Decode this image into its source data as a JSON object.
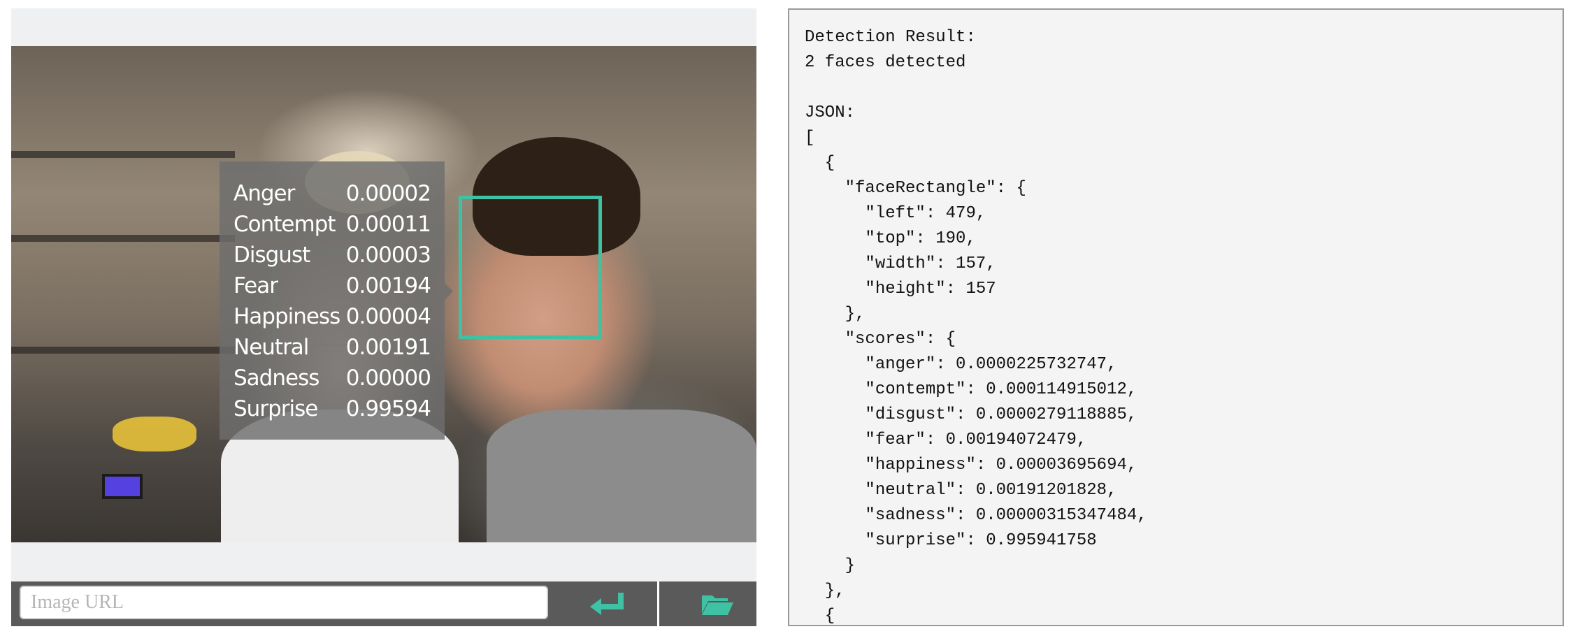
{
  "emotion_panel": {
    "scores": [
      {
        "label": "Anger",
        "value": "0.00002"
      },
      {
        "label": "Contempt",
        "value": "0.00011"
      },
      {
        "label": "Disgust",
        "value": "0.00003"
      },
      {
        "label": "Fear",
        "value": "0.00194"
      },
      {
        "label": "Happiness",
        "value": "0.00004"
      },
      {
        "label": "Neutral",
        "value": "0.00191"
      },
      {
        "label": "Sadness",
        "value": "0.00000"
      },
      {
        "label": "Surprise",
        "value": "0.99594"
      }
    ]
  },
  "toolbar": {
    "url_placeholder": "Image URL",
    "url_value": "",
    "submit_icon": "enter-arrow-icon",
    "browse_icon": "folder-open-icon",
    "accent_color": "#3fc1a4"
  },
  "colors": {
    "face_box": "#3fc1a4",
    "toolbar_bg": "#5a5a5a",
    "tooltip_bg": "#6e6e6e"
  },
  "result_panel": {
    "text": "Detection Result:\n2 faces detected\n\nJSON:\n[\n  {\n    \"faceRectangle\": {\n      \"left\": 479,\n      \"top\": 190,\n      \"width\": 157,\n      \"height\": 157\n    },\n    \"scores\": {\n      \"anger\": 0.0000225732747,\n      \"contempt\": 0.000114915012,\n      \"disgust\": 0.0000279118885,\n      \"fear\": 0.00194072479,\n      \"happiness\": 0.00003695694,\n      \"neutral\": 0.00191201828,\n      \"sadness\": 0.00000315347484,\n      \"surprise\": 0.995941758\n    }\n  },\n  {"
  }
}
